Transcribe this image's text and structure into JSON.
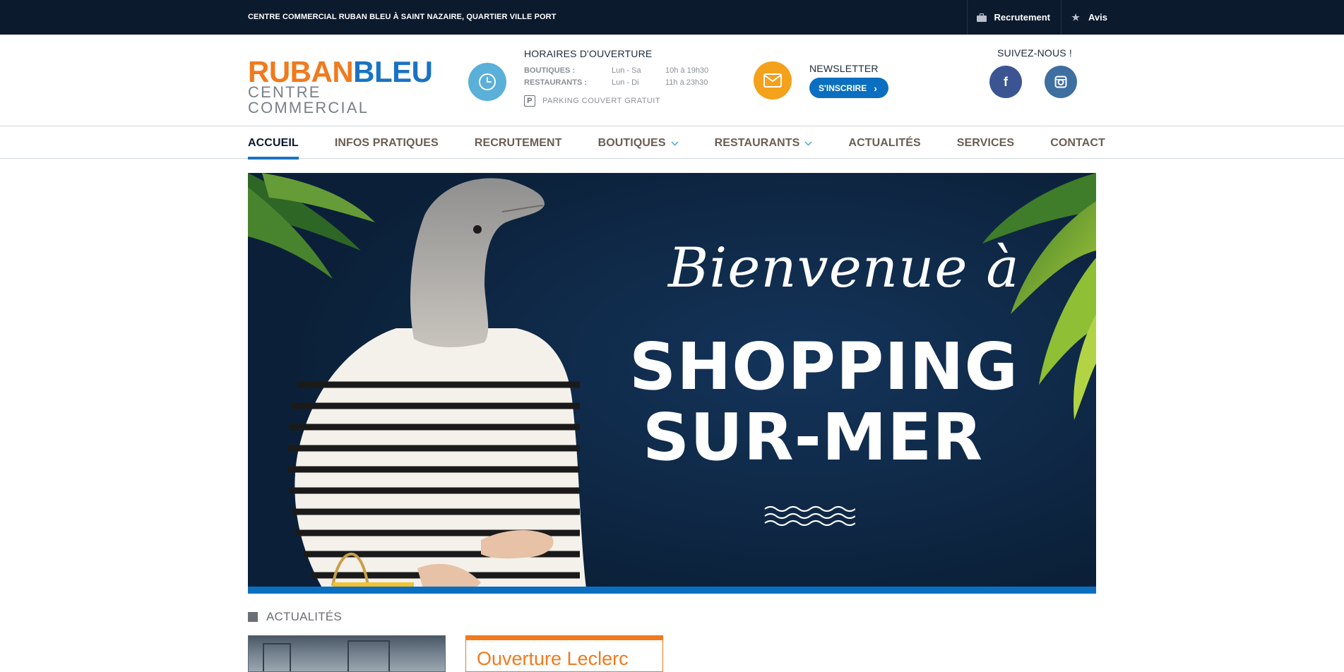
{
  "topbar": {
    "tagline": "CENTRE COMMERCIAL RUBAN BLEU À SAINT NAZAIRE, QUARTIER VILLE PORT",
    "links": [
      {
        "label": "Recrutement",
        "icon": "briefcase-icon"
      },
      {
        "label": "Avis",
        "icon": "star-icon"
      }
    ]
  },
  "logo": {
    "line1_a": "RUBAN",
    "line1_b": "BLEU",
    "line2": "CENTRE COMMERCIAL"
  },
  "hours": {
    "title": "HORAIRES D'OUVERTURE",
    "rows": [
      {
        "label": "BOUTIQUES :",
        "days": "Lun - Sa",
        "time": "10h à 19h30"
      },
      {
        "label": "RESTAURANTS :",
        "days": "Lun - Di",
        "time": "11h à 23h30"
      }
    ],
    "parking_icon_letter": "P",
    "parking": "PARKING COUVERT GRATUIT"
  },
  "newsletter": {
    "title": "NEWSLETTER",
    "button": "S'INSCRIRE"
  },
  "social": {
    "title": "SUIVEZ-NOUS !",
    "facebook_glyph": "f",
    "instagram_icon": "instagram-icon"
  },
  "nav": {
    "items": [
      {
        "label": "ACCUEIL",
        "active": true,
        "dropdown": false
      },
      {
        "label": "INFOS PRATIQUES",
        "active": false,
        "dropdown": false
      },
      {
        "label": "RECRUTEMENT",
        "active": false,
        "dropdown": false
      },
      {
        "label": "BOUTIQUES",
        "active": false,
        "dropdown": true
      },
      {
        "label": "RESTAURANTS",
        "active": false,
        "dropdown": true
      },
      {
        "label": "ACTUALITÉS",
        "active": false,
        "dropdown": false
      },
      {
        "label": "SERVICES",
        "active": false,
        "dropdown": false
      },
      {
        "label": "CONTACT",
        "active": false,
        "dropdown": false
      }
    ]
  },
  "hero": {
    "script": "Bienvenue à",
    "line1": "SHOPPING",
    "line2": "SUR-MER"
  },
  "news": {
    "title": "ACTUALITÉS",
    "card_title": "Ouverture Leclerc"
  },
  "colors": {
    "topbar": "#0c1a2e",
    "brand_orange": "#f07a1e",
    "brand_blue": "#1a73c2",
    "clock_circle": "#5ab0d8",
    "mail_circle": "#f4a11c",
    "facebook": "#3b5592",
    "instagram": "#3e6fa0"
  }
}
